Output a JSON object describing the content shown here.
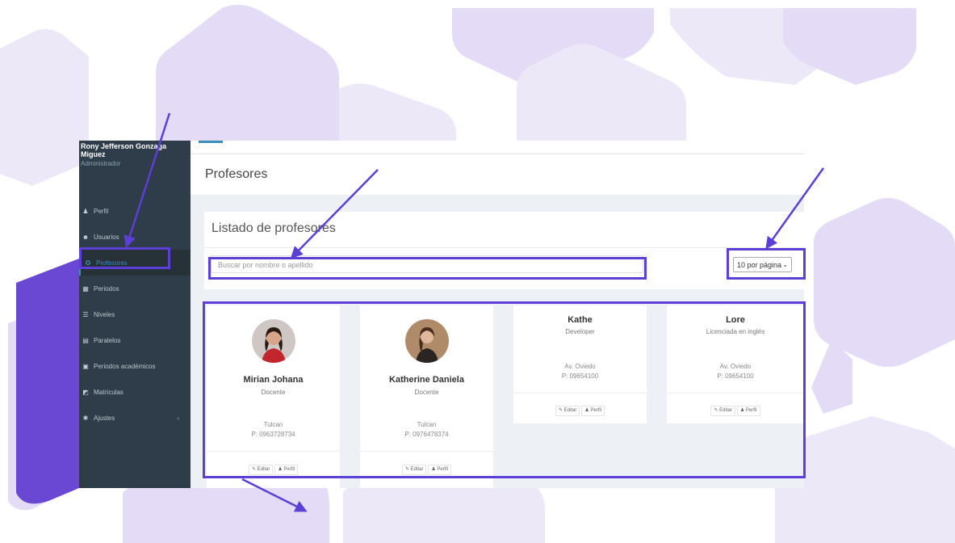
{
  "user": {
    "name": "Rony Jefferson Gonzaga Miguez",
    "role": "Administrador"
  },
  "sidebar": {
    "items": [
      {
        "label": "Perfil",
        "icon": "user-icon",
        "glyph": "♟"
      },
      {
        "label": "Usuarios",
        "icon": "users-icon",
        "glyph": "☻"
      },
      {
        "label": "Profesores",
        "icon": "teacher-icon",
        "glyph": "✪",
        "active": true
      },
      {
        "label": "Periodos",
        "icon": "table-icon",
        "glyph": "▦"
      },
      {
        "label": "Niveles",
        "icon": "list-icon",
        "glyph": "☰"
      },
      {
        "label": "Paralelos",
        "icon": "grid-icon",
        "glyph": "▤"
      },
      {
        "label": "Periodos académicos",
        "icon": "calendar-icon",
        "glyph": "▣"
      },
      {
        "label": "Matrículas",
        "icon": "book-icon",
        "glyph": "◩"
      },
      {
        "label": "Ajustes",
        "icon": "gear-icon",
        "glyph": "✱"
      }
    ],
    "chevron": "‹"
  },
  "header": {
    "title": "Profesores"
  },
  "panel": {
    "title": "Listado de profesores",
    "search_placeholder": "Buscar por nombre o apellido",
    "page_size": "10 por página",
    "caret": "⌄"
  },
  "buttons": {
    "edit": "✎ Editar",
    "profile": "♟ Perfil"
  },
  "teachers": [
    {
      "name": "Mirian Johana",
      "role": "Docente",
      "city": "Tulcan",
      "phone": "P: 0963728734"
    },
    {
      "name": "Katherine Daniela",
      "role": "Docente",
      "city": "Tulcan",
      "phone": "P: 0976478374"
    },
    {
      "name": "Kathe",
      "role": "Developer",
      "city": "Av. Oviedo",
      "phone": "P: 09654100"
    },
    {
      "name": "Lore",
      "role": "Licenciada en inglés",
      "city": "Av. Oviedo",
      "phone": "P: 09654100"
    }
  ],
  "colors": {
    "annotation": "#5b3fd6",
    "sidebar_bg": "#2f3d4a",
    "accent": "#3c8dbc"
  }
}
